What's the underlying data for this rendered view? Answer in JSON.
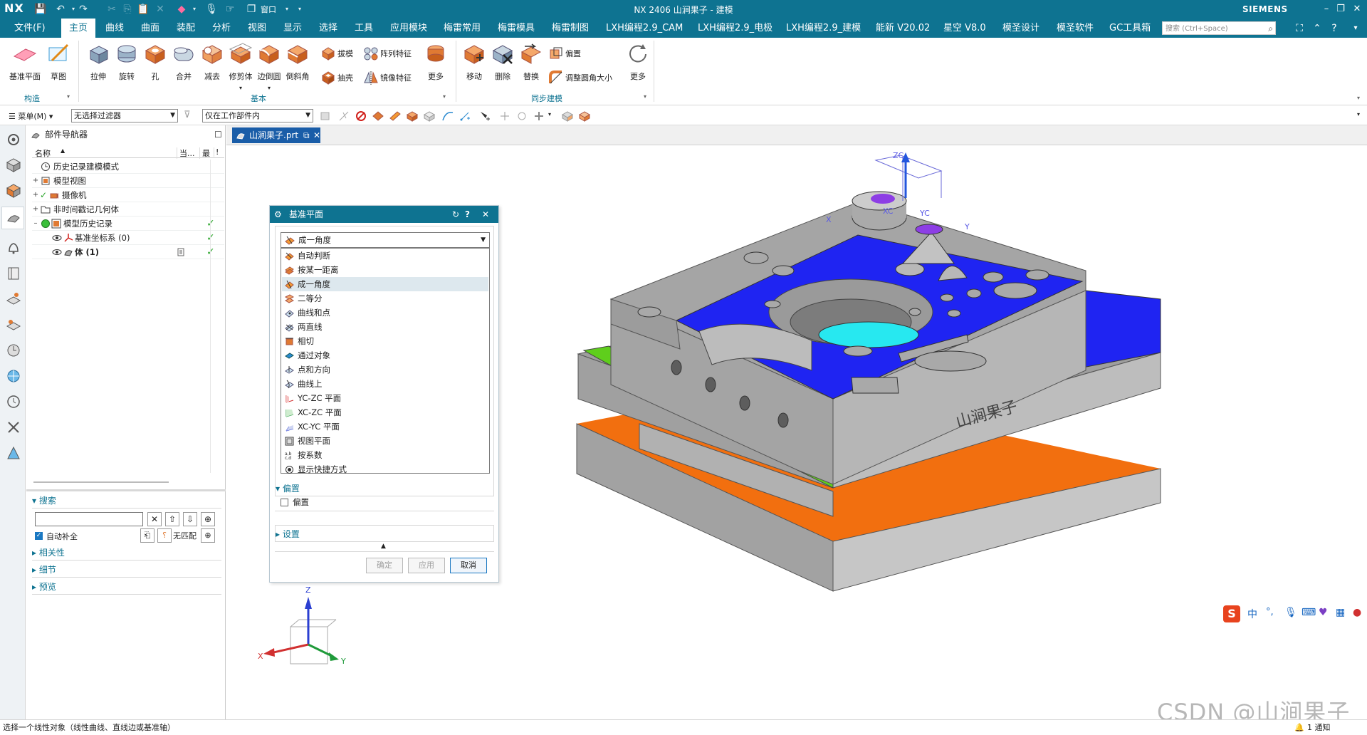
{
  "title_bar": {
    "logo": "NX",
    "title": "NX 2406 山涧果子 - 建模",
    "brand": "SIEMENS",
    "quick_access_menu": "窗口",
    "minimize": "–",
    "restore": "❐",
    "close": "✕"
  },
  "menu": {
    "file": "文件(F)",
    "tabs": [
      "主页",
      "曲线",
      "曲面",
      "装配",
      "分析",
      "视图",
      "显示",
      "选择",
      "工具",
      "应用模块",
      "梅雷常用",
      "梅雷模具",
      "梅雷制图",
      "LXH编程2.9_CAM",
      "LXH编程2.9_电极",
      "LXH编程2.9_建模",
      "能新 V20.02",
      "星空 V8.0",
      "模圣设计",
      "模圣软件",
      "GC工具箱"
    ],
    "active_tab": "主页",
    "search_placeholder": "搜索 (Ctrl+Space)"
  },
  "ribbon": {
    "construct": {
      "items": [
        "基准平面",
        "草图"
      ],
      "group": "构造"
    },
    "basic": {
      "items": [
        "拉伸",
        "旋转",
        "孔",
        "合并",
        "减去",
        "修剪体",
        "边倒圆",
        "倒斜角"
      ],
      "small": [
        "拔模",
        "阵列特征",
        "抽壳",
        "镜像特征"
      ],
      "more": "更多",
      "group": "基本"
    },
    "sync": {
      "items": [
        "移动",
        "删除",
        "替换"
      ],
      "small": [
        "偏置",
        "调整圆角大小"
      ],
      "more": "更多",
      "group": "同步建模"
    }
  },
  "toolbar": {
    "menu": "菜单(M)",
    "filter": "无选择过滤器",
    "scope": "仅在工作部件内"
  },
  "navigator": {
    "title": "部件导航器",
    "columns": [
      "名称",
      "当...",
      "最",
      "!"
    ],
    "rows": [
      {
        "label": "历史记录建模模式",
        "check": ""
      },
      {
        "label": "模型视图",
        "check": ""
      },
      {
        "label": "摄像机",
        "check": ""
      },
      {
        "label": "非时间戳记几何体",
        "check": ""
      },
      {
        "label": "模型历史记录",
        "check": "✓"
      },
      {
        "label": "基准坐标系 (0)",
        "check": "✓"
      },
      {
        "label": "体 (1)",
        "check": "✓"
      }
    ],
    "search": {
      "title": "搜索",
      "autocomplete": "自动补全",
      "nomatch": "无匹配"
    },
    "sections": [
      "相关性",
      "细节",
      "预览"
    ]
  },
  "graphics": {
    "tab_label": "山涧果子.prt",
    "part_label": "山涧果子",
    "axes": {
      "zc": "ZC",
      "yc": "YC",
      "xc": "XC",
      "x": "X",
      "y": "Y",
      "z": "Z"
    }
  },
  "dialog": {
    "title": "基准平面",
    "selected": "成一角度",
    "options": [
      "自动判断",
      "按某一距离",
      "成一角度",
      "二等分",
      "曲线和点",
      "两直线",
      "相切",
      "通过对象",
      "点和方向",
      "曲线上",
      "YC-ZC 平面",
      "XC-ZC 平面",
      "XC-YC 平面",
      "视图平面",
      "按系数",
      "显示快捷方式"
    ],
    "offset_section": "偏置",
    "offset_checkbox": "偏置",
    "settings_section": "设置",
    "buttons": {
      "ok": "确定",
      "apply": "应用",
      "cancel": "取消"
    }
  },
  "status": {
    "message": "选择一个线性对象（线性曲线、直线边或基准轴）",
    "notifications": "1 通知"
  },
  "watermark": "CSDN @山涧果子",
  "ime": {
    "lang": "中"
  },
  "colors": {
    "accent": "#0e7391",
    "face_blue": "#1f24f2",
    "face_orange": "#f26f0f",
    "face_green": "#5fce1c",
    "face_cyan": "#27e8f0",
    "body_gray": "#b4b4b4"
  }
}
